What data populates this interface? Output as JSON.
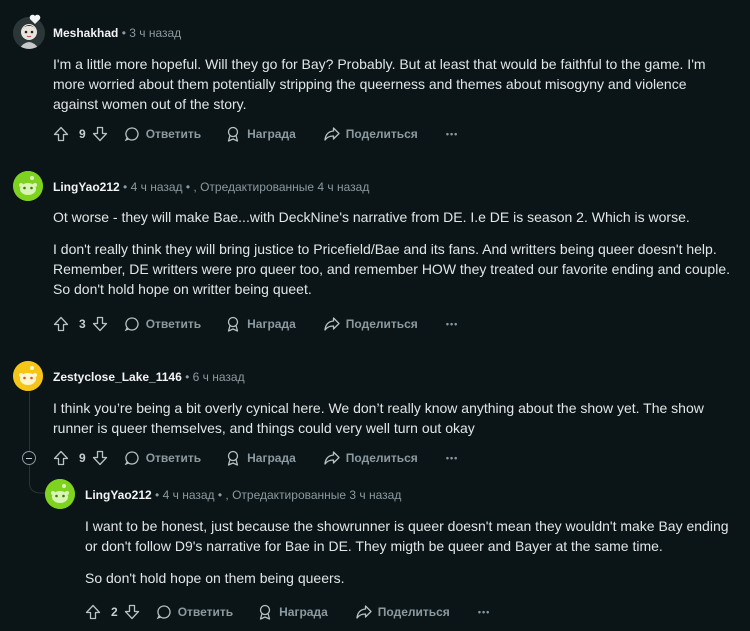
{
  "comments": [
    {
      "user": "Meshakhad",
      "time": "3 ч назад",
      "edited": "",
      "paragraphs": [
        "I'm a little more hopeful. Will they go for Bay? Probably. But at least that would be faithful to the game. I'm more worried about them potentially stripping the queerness and themes about misogyny and violence against women out of the story."
      ],
      "votes": "9"
    },
    {
      "user": "LingYao212",
      "time": "4 ч назад",
      "edited": ", Отредактированные 4 ч назад",
      "paragraphs": [
        "Ot worse - they will make Bae...with DeckNine's narrative from DE. I.e DE is season 2. Which is worse.",
        "I don't really think they will bring justice to Pricefield/Bae and its fans. And writters being queer doesn't help. Remember, DE writters were pro queer too, and remember HOW they treated our favorite ending and couple. So don't hold hope on writter being queet."
      ],
      "votes": "3"
    },
    {
      "user": "Zestyclose_Lake_1146",
      "time": "6 ч назад",
      "edited": "",
      "paragraphs": [
        "I think you’re being a bit overly cynical here. We don’t really know anything about the show yet. The show runner is queer themselves, and things could very well turn out okay"
      ],
      "votes": "9"
    },
    {
      "user": "LingYao212",
      "time": "4 ч назад",
      "edited": ", Отредактированные 3 ч назад",
      "paragraphs": [
        "I want to  be honest, just because the showrunner is queer doesn't mean they wouldn't make Bay ending or don't follow D9's narrative for Bae in DE. They migth be queer and Bayer at the same time.",
        "So don't hold hope on them being queers."
      ],
      "votes": "2"
    }
  ],
  "actions": {
    "reply": "Ответить",
    "award": "Награда",
    "share": "Поделиться",
    "more": "•••"
  },
  "separator": "•",
  "colors": {
    "background": "#0b1416",
    "text": "#e2e6e8",
    "meta": "#8b9aa1",
    "avatar_green": "#7ed321",
    "avatar_yellow": "#f5c518"
  }
}
